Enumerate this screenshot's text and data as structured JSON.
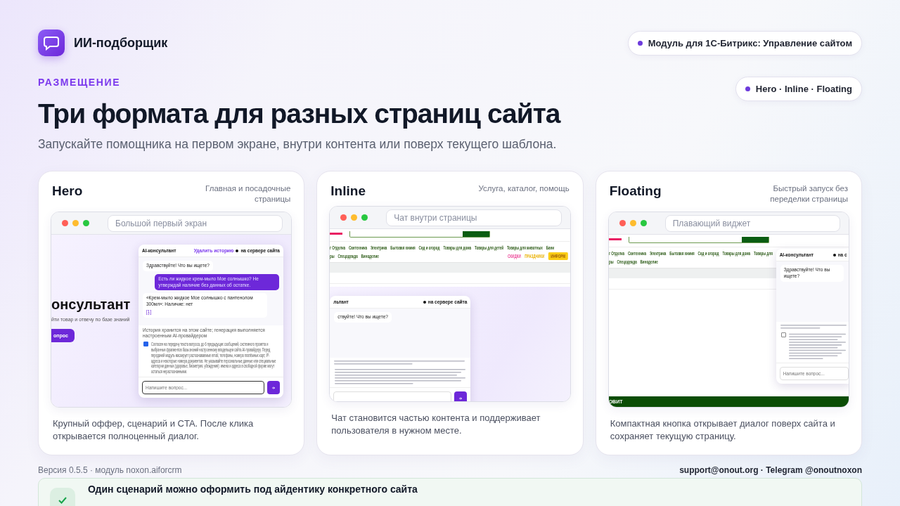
{
  "brand": {
    "name": "ИИ-подборщик"
  },
  "badges": [
    {
      "label": "Модуль для 1С-Битрикс: Управление сайтом"
    },
    {
      "label": "Hero · Inline · Floating"
    }
  ],
  "eyebrow": "РАЗМЕЩЕНИЕ",
  "title": "Три формата для разных страниц сайта",
  "subtitle": "Запускайте помощника на первом экране, внутри контента или поверх текущего шаблона.",
  "cards": [
    {
      "kind": "hero",
      "title": "Hero",
      "note": "Главная и посадочные страницы",
      "url_placeholder": "Большой первый экран",
      "description": "Крупный оффер, сценарий и CTA. После клика открывается полноценный диалог.",
      "preview": {
        "hero_title": "онсультант",
        "hero_subtitle": "йти товар и отвечу по базе знаний",
        "hero_button": "опрос",
        "chat": {
          "title": "AI-консультант",
          "clear_link": "Удалить историю",
          "status": "на сервере сайта",
          "messages": [
            {
              "kind": "bot",
              "text": "Здравствуйте! Что вы ищете?"
            },
            {
              "kind": "user",
              "text": "Есть ли жидкое крем-мыло Мое солнышко? Не утверждай наличие без данных об остатке."
            },
            {
              "kind": "bot",
              "text": "«Крем-мыло жидкое Мое солнышко с пантенолом 300мл»: Наличие: нет",
              "link": "[1]"
            }
          ],
          "notice": "История хранится на этом сайте; генерация выполняется настроенным AI-провайдером",
          "consent": {
            "checked": true,
            "text": "Согласен на передачу текста вопроса, до 6 предыдущих сообщений, системного промпта и выбранных фрагментов базы знаний настроенному владельцем сайта AI-провайдеру. Перед передачей модуль маскирует распознаваемые email, телефоны, номера платёжных карт, IP-адреса и некоторые номера документов. Не указывайте персональные данные или специальные категории данных (здоровье, биометрия, убеждения): имена и адреса в свободной форме могут остаться нераспознанными."
          },
          "input_placeholder": "Напишите вопрос..."
        }
      }
    },
    {
      "kind": "inline",
      "title": "Inline",
      "note": "Услуга, каталог, помощь",
      "url_placeholder": "Чат внутри страницы",
      "description": "Чат становится частью контента и поддерживает пользователя в нужном месте.",
      "preview": {
        "site": {
          "nav": [
            "г Отделка",
            "Сантехника",
            "Электрика",
            "Бытовая химия",
            "Сад и огород",
            "Товары для дома",
            "Товары для детей",
            "Товары для животных",
            "Бани"
          ],
          "nav2": [
            "ры",
            "Спецодежда",
            "Виноделие"
          ],
          "promos": [
            {
              "kind": "sale",
              "text": "СКИДКИ"
            },
            {
              "kind": "holiday",
              "text": "ПРАЗДНИКИ"
            },
            {
              "kind": "info",
              "text": "ИНФОРМ"
            }
          ]
        },
        "chat": {
          "title": "льтант",
          "status": "на сервере сайта",
          "messages": [
            {
              "kind": "bot",
              "text": "ствуйте! Что вы ищете?"
            }
          ]
        }
      }
    },
    {
      "kind": "floating",
      "title": "Floating",
      "note": "Быстрый запуск без переделки страницы",
      "url_placeholder": "Плавающий виджет",
      "description": "Компактная кнопка открывает диалог поверх сайта и сохраняет текущую страницу.",
      "preview": {
        "site": {
          "nav": [
            "г Отделка",
            "Сантехника",
            "Электрика",
            "Бытовая химия",
            "Сад и огород",
            "Товары для дома",
            "Товары для"
          ],
          "nav2": [
            "ры",
            "Спецодежда",
            "Виноделие"
          ],
          "footer_logo": "ОВИТ"
        },
        "chat": {
          "title": "AI-консультант",
          "status": "на с",
          "messages": [
            {
              "kind": "bot",
              "text": "Здравствуйте! Что вы ищете?"
            }
          ],
          "consent": {
            "checked": false
          },
          "input_placeholder": "Напишите вопрос..."
        }
      }
    }
  ],
  "footer": {
    "version": "Версия 0.5.5 · модуль noxon.aiforcrm",
    "contacts": "support@onout.org · Telegram @onoutnoxon"
  },
  "banner": {
    "text": "Один сценарий можно оформить под айдентику конкретного сайта"
  }
}
